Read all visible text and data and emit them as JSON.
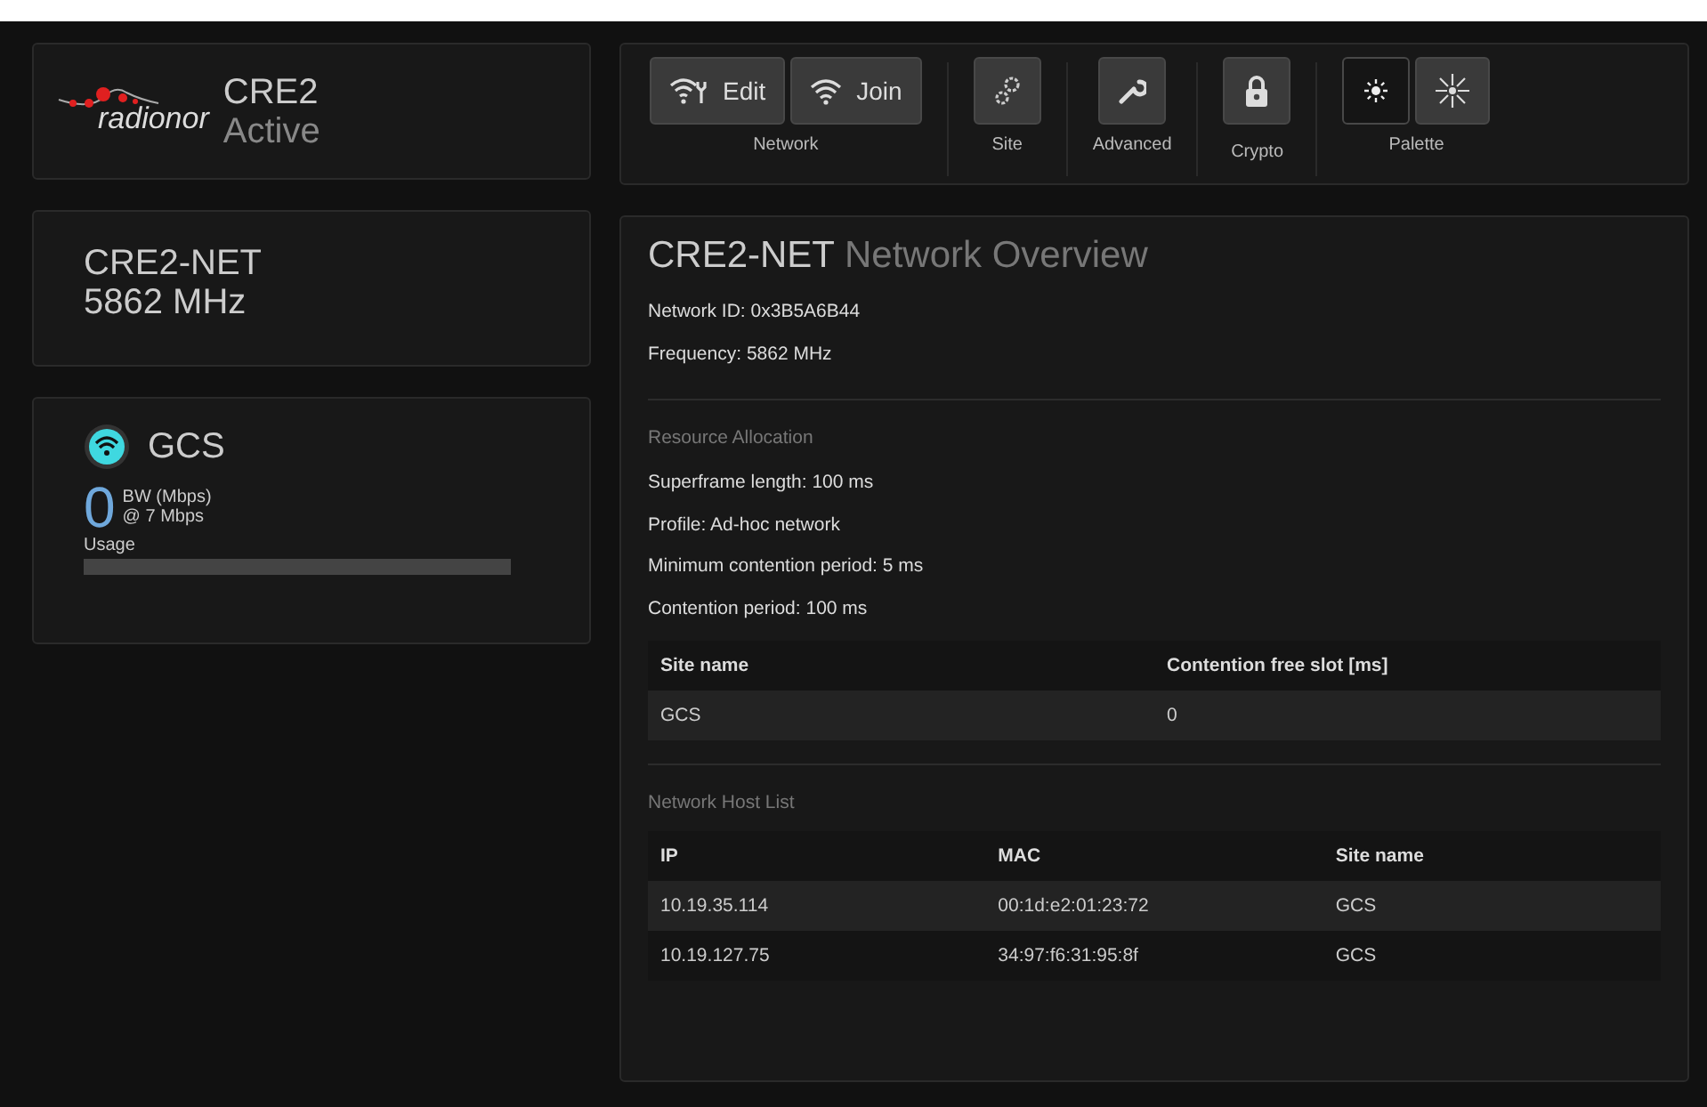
{
  "brand": {
    "logo_text": "radionor",
    "device": "CRE2",
    "status": "Active"
  },
  "network_card": {
    "name": "CRE2-NET",
    "frequency": "5862 MHz"
  },
  "site_card": {
    "name": "GCS",
    "bandwidth": "0",
    "bw_label": "BW (Mbps)",
    "bw_rate": "@ 7 Mbps",
    "usage_label": "Usage",
    "usage": {
      "level": 0
    }
  },
  "toolbar": [
    {
      "label": "Network",
      "buttons": [
        {
          "kind": "edit",
          "text": "Edit",
          "selected": false
        },
        {
          "kind": "join",
          "text": "Join",
          "selected": false
        }
      ]
    },
    {
      "label": "Site",
      "buttons": [
        {
          "kind": "site",
          "selected": false
        }
      ]
    },
    {
      "label": "Advanced",
      "buttons": [
        {
          "kind": "advanced",
          "selected": false
        }
      ]
    },
    {
      "label": "Crypto",
      "buttons": [
        {
          "kind": "crypto",
          "selected": false
        }
      ]
    },
    {
      "label": "Palette",
      "buttons": [
        {
          "kind": "dark",
          "selected": true
        },
        {
          "kind": "light",
          "selected": false
        }
      ]
    }
  ],
  "overview": {
    "title": "CRE2-NET",
    "subtitle": "Network Overview",
    "lines": [
      "Network ID: 0x3B5A6B44",
      "Frequency: 5862 MHz"
    ],
    "resource": {
      "heading": "Resource Allocation",
      "lines": [
        "Superframe length: 100 ms",
        "Profile: Ad-hoc network",
        "Minimum contention period: 5 ms",
        "Contention period: 100 ms"
      ],
      "table": {
        "columns": [
          "Site name",
          "Contention free slot [ms]"
        ],
        "rows": [
          [
            "GCS",
            "0"
          ]
        ]
      }
    },
    "hosts": {
      "heading": "Network Host List",
      "table": {
        "columns": [
          "IP",
          "MAC",
          "Site name"
        ],
        "rows": [
          [
            "10.19.35.114",
            "00:1d:e2:01:23:72",
            "GCS"
          ],
          [
            "10.19.127.75",
            "34:97:f6:31:95:8f",
            "GCS"
          ]
        ]
      }
    }
  }
}
